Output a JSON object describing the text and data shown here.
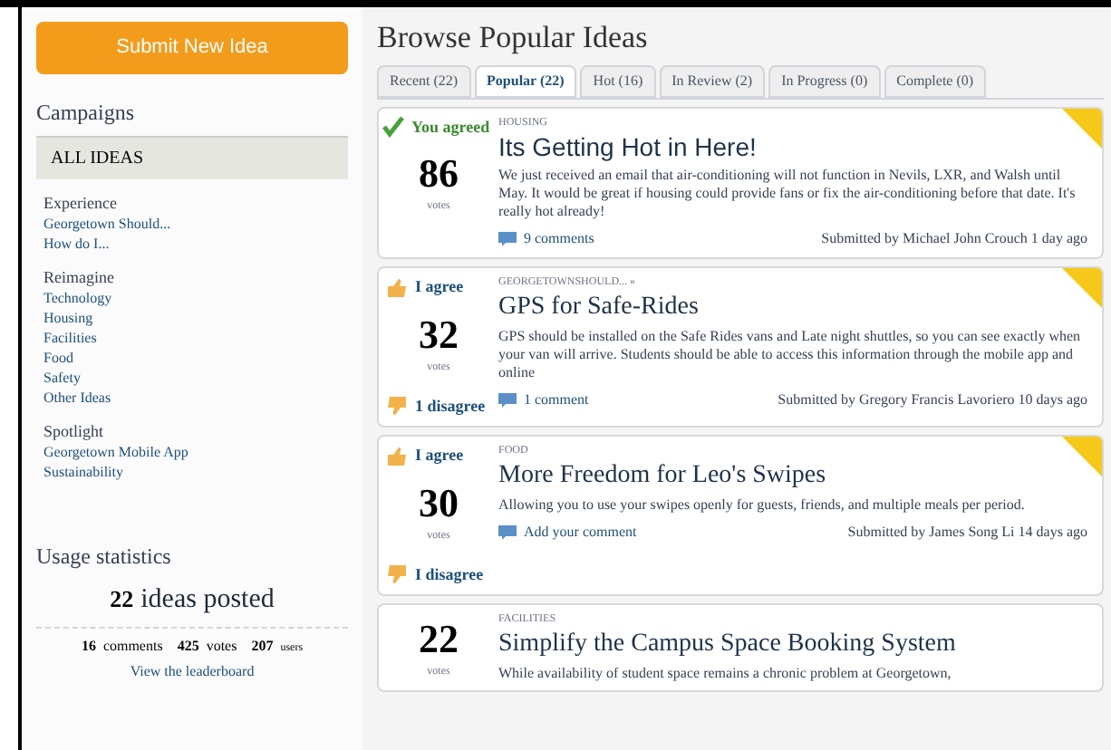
{
  "submit_button": "Submit New Idea",
  "campaigns": {
    "title": "Campaigns",
    "all": {
      "label": "ALL IDEAS",
      "selected": true
    },
    "groups": [
      {
        "heading": "Experience",
        "links": [
          "Georgetown Should...",
          "How do I..."
        ]
      },
      {
        "heading": "Reimagine",
        "links": [
          "Technology",
          "Housing",
          "Facilities",
          "Food",
          "Safety",
          "Other Ideas"
        ]
      },
      {
        "heading": "Spotlight",
        "links": [
          "Georgetown Mobile App",
          "Sustainability"
        ]
      }
    ]
  },
  "usage": {
    "title": "Usage statistics",
    "ideas": "22",
    "ideas_label": "ideas posted",
    "comments": "16",
    "comments_label": "comments",
    "votes": "425",
    "votes_label": "votes",
    "users": "207",
    "users_label": "users",
    "leaderboard": "View the leaderboard"
  },
  "page_title": "Browse Popular Ideas",
  "tabs": [
    {
      "label": "Recent (22)",
      "selected": false
    },
    {
      "label": "Popular (22)",
      "selected": true
    },
    {
      "label": "Hot (16)",
      "selected": false
    },
    {
      "label": "In Review (2)",
      "selected": false
    },
    {
      "label": "In Progress (0)",
      "selected": false
    },
    {
      "label": "Complete (0)",
      "selected": false
    }
  ],
  "ideas": [
    {
      "kind": "agreed",
      "agree": "You agreed",
      "votes": "86",
      "votes_label": "votes",
      "category": "HOUSING",
      "title": "Its Getting Hot in Here!",
      "description": "We just received an email that air-conditioning will not function in Nevils, LXR, and Walsh until May. It would be great if housing could provide fans or fix the air-conditioning before that date. It's really hot already!",
      "comments": "9 comments",
      "submitted": "Submitted by Michael John Crouch 1 day ago"
    },
    {
      "kind": "open",
      "agree": "I agree",
      "disagree": "1 disagree",
      "votes": "32",
      "votes_label": "votes",
      "category": "GEORGETOWNSHOULD... »",
      "title": "GPS for Safe-Rides",
      "description": "GPS should be installed on the Safe Rides vans and Late night shuttles, so you can see exactly when your van will arrive. Students should be able to access this information through the mobile app and online",
      "comments": "1 comment",
      "submitted": "Submitted by Gregory Francis Lavoriero 10 days ago"
    },
    {
      "kind": "open",
      "agree": "I agree",
      "disagree": "I disagree",
      "votes": "30",
      "votes_label": "votes",
      "category": "FOOD",
      "title": "More Freedom for Leo's Swipes",
      "description": "Allowing you to use your swipes openly for guests, friends, and multiple meals per period.",
      "comments": "Add your comment",
      "submitted": "Submitted by James Song Li 14 days ago"
    },
    {
      "kind": "none",
      "votes": "22",
      "votes_label": "votes",
      "category": "FACILITIES",
      "title": "Simplify the Campus Space Booking System",
      "description": "While availability of student space remains a chronic problem at Georgetown,"
    }
  ]
}
